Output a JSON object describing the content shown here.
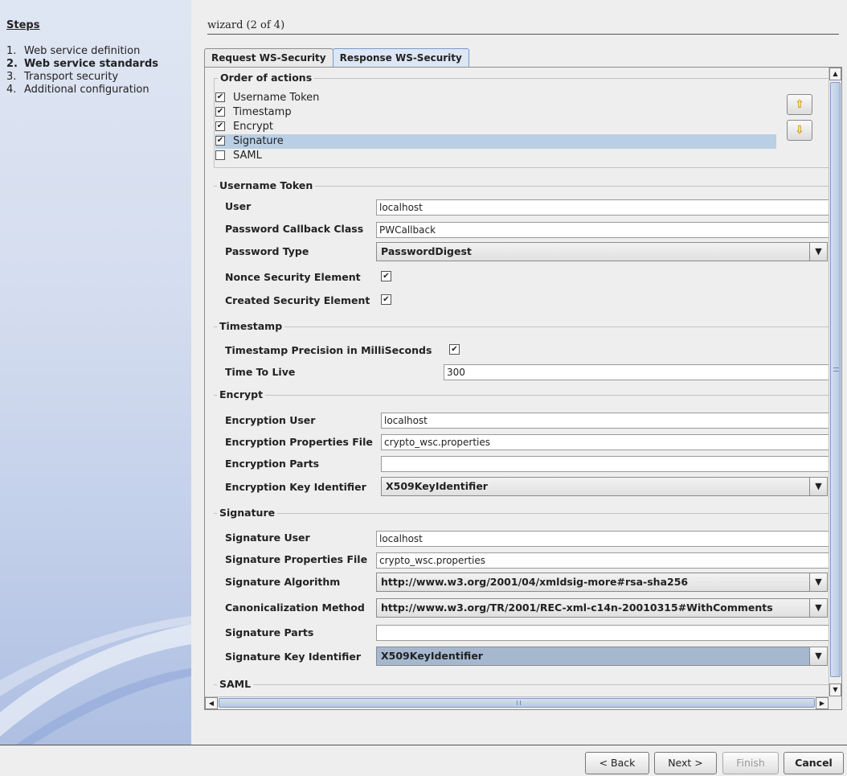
{
  "steps": {
    "title": "Steps",
    "items": [
      {
        "num": "1.",
        "label": "Web service definition",
        "active": false
      },
      {
        "num": "2.",
        "label": "Web service standards",
        "active": true
      },
      {
        "num": "3.",
        "label": "Transport security",
        "active": false
      },
      {
        "num": "4.",
        "label": "Additional configuration",
        "active": false
      }
    ]
  },
  "wizard": {
    "title": "wizard (2 of 4)",
    "tabs": [
      {
        "label": "Request WS-Security",
        "selected": false
      },
      {
        "label": "Response WS-Security",
        "selected": true
      }
    ]
  },
  "order": {
    "label": "Order of actions",
    "items": [
      {
        "label": "Username Token",
        "checked": true
      },
      {
        "label": "Timestamp",
        "checked": true
      },
      {
        "label": "Encrypt",
        "checked": true
      },
      {
        "label": "Signature",
        "checked": true,
        "selected": true
      },
      {
        "label": "SAML",
        "checked": false
      }
    ],
    "up_icon": "arrow-up-icon",
    "down_icon": "arrow-down-icon"
  },
  "username_token": {
    "label": "Username Token",
    "user_label": "User",
    "user_value": "localhost",
    "callback_label": "Password Callback Class",
    "callback_value": "PWCallback",
    "pwtype_label": "Password Type",
    "pwtype_value": "PasswordDigest",
    "nonce_label": "Nonce Security Element",
    "nonce_checked": true,
    "created_label": "Created Security Element",
    "created_checked": true
  },
  "timestamp": {
    "label": "Timestamp",
    "precision_label": "Timestamp Precision in MilliSeconds",
    "precision_checked": true,
    "ttl_label": "Time To Live",
    "ttl_value": "300"
  },
  "encrypt": {
    "label": "Encrypt",
    "user_label": "Encryption User",
    "user_value": "localhost",
    "props_label": "Encryption Properties File",
    "props_value": "crypto_wsc.properties",
    "parts_label": "Encryption Parts",
    "parts_value": "",
    "keyid_label": "Encryption Key Identifier",
    "keyid_value": "X509KeyIdentifier"
  },
  "signature": {
    "label": "Signature",
    "user_label": "Signature User",
    "user_value": "localhost",
    "props_label": "Signature Properties File",
    "props_value": "crypto_wsc.properties",
    "algo_label": "Signature Algorithm",
    "algo_value": "http://www.w3.org/2001/04/xmldsig-more#rsa-sha256",
    "canon_label": "Canonicalization Method",
    "canon_value": "http://www.w3.org/TR/2001/REC-xml-c14n-20010315#WithComments",
    "parts_label": "Signature Parts",
    "parts_value": "",
    "keyid_label": "Signature Key Identifier",
    "keyid_value": "X509KeyIdentifier"
  },
  "saml": {
    "label": "SAML"
  },
  "buttons": {
    "back": "< Back",
    "next": "Next >",
    "finish": "Finish",
    "cancel": "Cancel"
  },
  "glyphs": {
    "check": "✔",
    "drop": "▼",
    "up": "▲",
    "down": "▼",
    "left": "◀",
    "right": "▶",
    "arrow_up": "⇧",
    "arrow_down": "⇩"
  }
}
